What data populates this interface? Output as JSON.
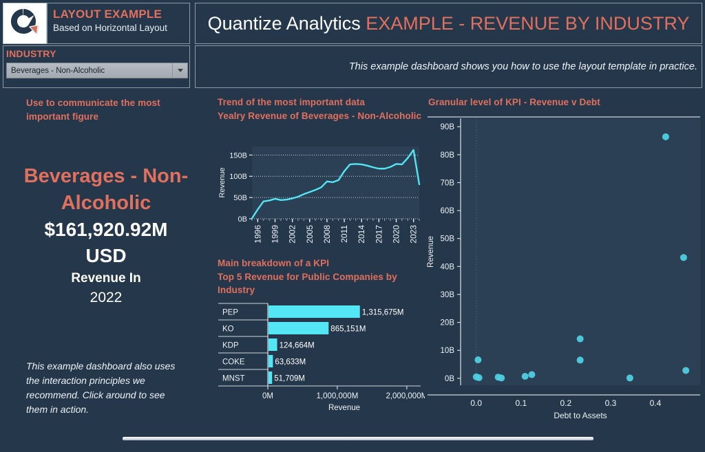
{
  "header": {
    "logo_name": "quantize-donut-logo",
    "brand_title": "LAYOUT EXAMPLE",
    "brand_subtitle": "Based on Horizontal Layout",
    "title_main": "Quantize Analytics ",
    "title_accent": "EXAMPLE - REVENUE BY INDUSTRY"
  },
  "filter": {
    "label": "INDUSTRY",
    "selected": "Beverages - Non-Alcoholic",
    "placeholder": "Beverages - Non-Alcoholic",
    "options": [
      "Beverages - Non-Alcoholic"
    ]
  },
  "note": {
    "text": "This example dashboard shows you how to use the layout template in practice."
  },
  "kpi": {
    "caption": "Use to communicate the most important figure",
    "industry": "Beverages - Non-Alcoholic",
    "value": "$161,920.92M",
    "currency": "USD",
    "measure": "Revenue In",
    "year": "2022",
    "footnote": "This example dashboard also uses the interaction principles we recommend. Click around to see them in action."
  },
  "middle": {
    "line_caption_1": "Trend of the most important data",
    "line_caption_2": "Yealry Revenue of Beverages - Non-Alcoholic",
    "bar_caption_1": "Main breakdown of a KPI",
    "bar_caption_2": "Top 5 Revenue for Public Companies by Industry"
  },
  "right": {
    "caption": "Granular level of KPI - Revenue v Debt"
  },
  "colors": {
    "background": "#25374b",
    "accent_red": "#e1705e",
    "series_cyan": "#53e6f5",
    "text_light": "#eef2f6",
    "panel_border": "#8d9aa8"
  },
  "chart_data": [
    {
      "type": "line",
      "id": "yearly-revenue-line",
      "title": "Yealry Revenue of Beverages - Non-Alcoholic",
      "xlabel": "",
      "ylabel": "Revenue",
      "ytick_labels": [
        "0B",
        "50B",
        "100B",
        "150B"
      ],
      "ytick_values": [
        0,
        50,
        100,
        150
      ],
      "ylim": [
        0,
        170
      ],
      "xtick_labels": [
        "1996",
        "1999",
        "2002",
        "2005",
        "2008",
        "2011",
        "2014",
        "2017",
        "2020",
        "2023"
      ],
      "grid": true,
      "x": [
        1995,
        1996,
        1997,
        1998,
        1999,
        2000,
        2001,
        2002,
        2003,
        2004,
        2005,
        2006,
        2007,
        2008,
        2009,
        2010,
        2011,
        2012,
        2013,
        2014,
        2015,
        2016,
        2017,
        2018,
        2019,
        2020,
        2021,
        2022,
        2023,
        2024
      ],
      "values": [
        1,
        22,
        41,
        43,
        47,
        44,
        45,
        48,
        52,
        58,
        63,
        68,
        74,
        88,
        86,
        91,
        112,
        128,
        129,
        128,
        125,
        121,
        118,
        118,
        122,
        129,
        128,
        143,
        162,
        81
      ],
      "units": "B USD"
    },
    {
      "type": "bar",
      "id": "top5-revenue-bar",
      "orientation": "horizontal",
      "title": "Top 5 Revenue for Public Companies by Industry",
      "xlabel": "Revenue",
      "ylabel": "",
      "categories": [
        "PEP",
        "KO",
        "KDP",
        "COKE",
        "MNST"
      ],
      "values": [
        1315675,
        865151,
        124664,
        63633,
        51709
      ],
      "value_labels": [
        "1,315,675M",
        "865,151M",
        "124,664M",
        "63,633M",
        "51,709M"
      ],
      "xtick_labels": [
        "0M",
        "1,000,000M",
        "2,000,000M"
      ],
      "xtick_values": [
        0,
        1000000,
        2000000
      ],
      "xlim": [
        0,
        2200000
      ],
      "grid": false
    },
    {
      "type": "scatter",
      "id": "revenue-v-debt-scatter",
      "title": "Granular level of KPI - Revenue v Debt",
      "xlabel": "Debt to Assets",
      "ylabel": "Revenue",
      "xtick_labels": [
        "0.0",
        "0.1",
        "0.2",
        "0.3",
        "0.4"
      ],
      "xtick_values": [
        0.0,
        0.1,
        0.2,
        0.3,
        0.4
      ],
      "xlim": [
        -0.035,
        0.5
      ],
      "ytick_labels": [
        "0B",
        "10B",
        "20B",
        "30B",
        "40B",
        "50B",
        "60B",
        "70B",
        "80B",
        "90B"
      ],
      "ytick_values": [
        0,
        10,
        20,
        30,
        40,
        50,
        60,
        70,
        80,
        90
      ],
      "ylim": [
        -2.5,
        93
      ],
      "grid": false,
      "points": [
        {
          "x": 0.423,
          "y": 86.4
        },
        {
          "x": 0.463,
          "y": 43.2
        },
        {
          "x": 0.232,
          "y": 14.1
        },
        {
          "x": 0.232,
          "y": 6.5
        },
        {
          "x": 0.004,
          "y": 6.6
        },
        {
          "x": 0.468,
          "y": 2.8
        },
        {
          "x": 0.124,
          "y": 1.3
        },
        {
          "x": 0.109,
          "y": 0.7
        },
        {
          "x": 0.0,
          "y": 0.5
        },
        {
          "x": 0.006,
          "y": 0.2
        },
        {
          "x": 0.049,
          "y": 0.4
        },
        {
          "x": 0.056,
          "y": 0.1
        },
        {
          "x": 0.343,
          "y": 0.1
        }
      ]
    }
  ]
}
